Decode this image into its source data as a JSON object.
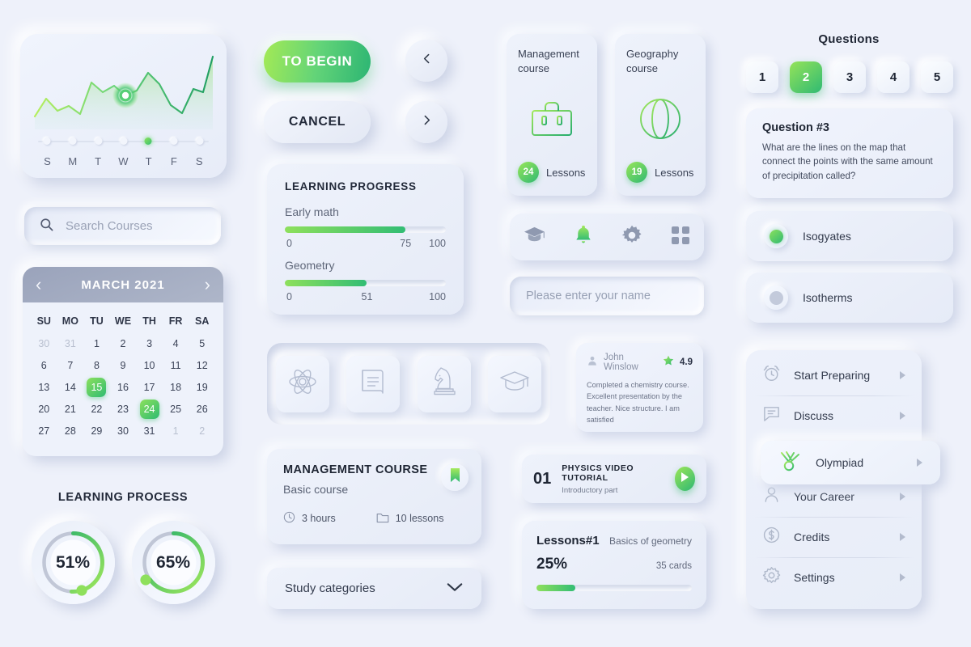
{
  "chart": {
    "days": [
      "S",
      "M",
      "T",
      "W",
      "T",
      "F",
      "S"
    ],
    "active_day_index": 4,
    "accent": "#3cbe72"
  },
  "chart_data": {
    "type": "area",
    "title": "",
    "xlabel": "",
    "ylabel": "",
    "x": [
      "S",
      "M",
      "T",
      "W",
      "T",
      "F",
      "S"
    ],
    "categories": [
      "S",
      "M",
      "T",
      "W",
      "T",
      "F",
      "S"
    ],
    "values": [
      28,
      55,
      38,
      44,
      34,
      78,
      62,
      72,
      56,
      64,
      88,
      70,
      46,
      30,
      66,
      62,
      95
    ],
    "ylim": [
      0,
      100
    ],
    "grid": false,
    "legend": null,
    "highlight_point": {
      "x_index": 8,
      "label": "T"
    }
  },
  "search": {
    "placeholder": "Search Courses",
    "value": "",
    "icon": "search-icon"
  },
  "calendar": {
    "title": "MARCH 2021",
    "prev_icon": "chevron-left-icon",
    "next_icon": "chevron-right-icon",
    "weekdays": [
      "SU",
      "MO",
      "TU",
      "WE",
      "TH",
      "FR",
      "SA"
    ],
    "weeks": [
      [
        {
          "d": "30",
          "muted": true
        },
        {
          "d": "31",
          "muted": true
        },
        {
          "d": "1"
        },
        {
          "d": "2"
        },
        {
          "d": "3"
        },
        {
          "d": "4"
        },
        {
          "d": "5"
        }
      ],
      [
        {
          "d": "6"
        },
        {
          "d": "7"
        },
        {
          "d": "8"
        },
        {
          "d": "9"
        },
        {
          "d": "10"
        },
        {
          "d": "11"
        },
        {
          "d": "12"
        }
      ],
      [
        {
          "d": "13"
        },
        {
          "d": "14"
        },
        {
          "d": "15",
          "selected": true
        },
        {
          "d": "16"
        },
        {
          "d": "17"
        },
        {
          "d": "18"
        },
        {
          "d": "19"
        }
      ],
      [
        {
          "d": "20"
        },
        {
          "d": "21"
        },
        {
          "d": "22"
        },
        {
          "d": "23"
        },
        {
          "d": "24",
          "selected": true
        },
        {
          "d": "25"
        },
        {
          "d": "26"
        }
      ],
      [
        {
          "d": "27"
        },
        {
          "d": "28"
        },
        {
          "d": "29"
        },
        {
          "d": "30"
        },
        {
          "d": "31"
        },
        {
          "d": "1",
          "muted": true
        },
        {
          "d": "2",
          "muted": true
        }
      ]
    ]
  },
  "learning_process": {
    "title": "LEARNING PROCESS",
    "gauges": [
      {
        "label": "51%",
        "value": 51
      },
      {
        "label": "65%",
        "value": 65
      }
    ]
  },
  "buttons": {
    "begin": "TO BEGIN",
    "cancel": "CANCEL",
    "prev_icon": "chevron-left-icon",
    "next_icon": "chevron-right-icon"
  },
  "learning_progress": {
    "title": "LEARNING PROGRESS",
    "items": [
      {
        "name": "Early math",
        "value": 75,
        "min_label": "0",
        "value_label": "75",
        "max_label": "100"
      },
      {
        "name": "Geometry",
        "value": 51,
        "min_label": "0",
        "value_label": "51",
        "max_label": "100"
      }
    ]
  },
  "courses": [
    {
      "name": "Management course",
      "icon": "briefcase-icon",
      "lessons": "24",
      "lessons_label": "Lessons"
    },
    {
      "name": "Geography course",
      "icon": "globe-icon",
      "lessons": "19",
      "lessons_label": "Lessons"
    }
  ],
  "icon_bar": [
    {
      "icon": "graduation-cap-icon",
      "active": false
    },
    {
      "icon": "bell-icon",
      "active": true
    },
    {
      "icon": "gear-icon",
      "active": false
    },
    {
      "icon": "grid-icon",
      "active": false
    }
  ],
  "name_field": {
    "placeholder": "Please enter your name",
    "value": ""
  },
  "subjects": [
    {
      "icon": "atom-icon"
    },
    {
      "icon": "book-icon"
    },
    {
      "icon": "chess-knight-icon"
    },
    {
      "icon": "graduation-cap-icon"
    }
  ],
  "testimonial": {
    "author": "John Winslow",
    "rating": "4.9",
    "avatar_icon": "user-icon",
    "star_icon": "star-icon",
    "text": "Completed a chemistry course. Excellent presentation by the teacher. Nice structure. I am satisfied"
  },
  "management_card": {
    "title": "MANAGEMENT COURSE",
    "subtitle": "Basic course",
    "duration": "3 hours",
    "duration_icon": "clock-icon",
    "lessons": "10 lessons",
    "lessons_icon": "folder-icon",
    "bookmark_icon": "bookmark-icon"
  },
  "study_categories": {
    "label": "Study categories",
    "icon": "chevron-down-icon"
  },
  "video_card": {
    "number": "01",
    "title": "PHYSICS VIDEO TUTORIAL",
    "subtitle": "Introductory part",
    "play_icon": "play-icon"
  },
  "lessons_card": {
    "title": "Lessons#1",
    "subtitle": "Basics of geometry",
    "percent_label": "25%",
    "percent": 25,
    "cards_label": "35 cards"
  },
  "questions": {
    "title": "Questions",
    "tabs": [
      {
        "label": "1",
        "active": false
      },
      {
        "label": "2",
        "active": true
      },
      {
        "label": "3",
        "active": false
      },
      {
        "label": "4",
        "active": false
      },
      {
        "label": "5",
        "active": false
      }
    ],
    "card": {
      "heading": "Question #3",
      "text": "What are the lines on the map that connect the points with the same amount of precipitation called?"
    },
    "answers": [
      {
        "label": "Isogyates",
        "selected": true
      },
      {
        "label": "Isotherms",
        "selected": false
      }
    ]
  },
  "menu": {
    "items": [
      {
        "label": "Start Preparing",
        "icon": "alarm-clock-icon",
        "active": false
      },
      {
        "label": "Discuss",
        "icon": "chat-icon",
        "active": false
      },
      {
        "label": "Olympiad",
        "icon": "laurel-medal-icon",
        "active": true
      },
      {
        "label": "Your Career",
        "icon": "user-icon",
        "active": false
      },
      {
        "label": "Credits",
        "icon": "dollar-coin-icon",
        "active": false
      },
      {
        "label": "Settings",
        "icon": "gear-icon",
        "active": false
      }
    ],
    "caret_icon": "caret-right-icon"
  },
  "colors": {
    "background": "#eef1fa",
    "accent_light": "#a2e85b",
    "accent_dark": "#2bb573",
    "text": "#1f2634",
    "muted": "#6a7287"
  }
}
